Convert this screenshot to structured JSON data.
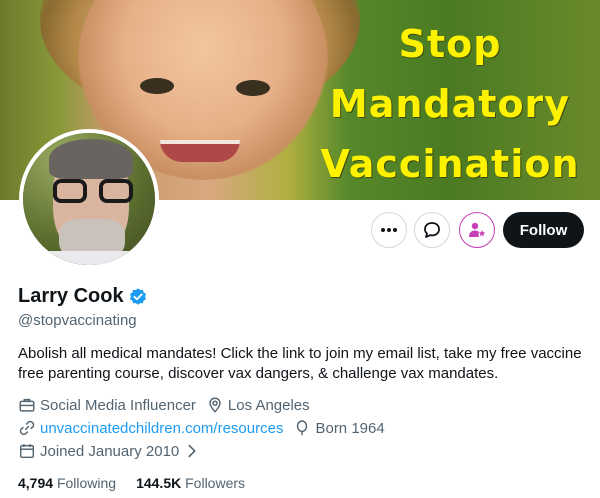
{
  "banner": {
    "text_lines": [
      "Stop",
      "Mandatory",
      "Vaccination"
    ]
  },
  "actions": {
    "more_icon": "more-dots-icon",
    "message_icon": "message-bubble-icon",
    "subscribe_icon": "subscribe-person-star-icon",
    "follow_label": "Follow"
  },
  "profile": {
    "name": "Larry Cook",
    "verified_icon": "verified-badge-icon",
    "handle": "@stopvaccinating",
    "bio": "Abolish all medical mandates! Click the link to join my email list, take my free vaccine free parenting course, discover vax dangers, & challenge vax mandates.",
    "category": "Social Media Influencer",
    "location": "Los Angeles",
    "website": "unvaccinatedchildren.com/resources",
    "born": "Born 1964",
    "joined": "Joined January 2010",
    "following_count": "4,794",
    "following_label": "Following",
    "followers_count": "144.5K",
    "followers_label": "Followers"
  },
  "colors": {
    "accent": "#1d9bf0",
    "text_primary": "#0f1419",
    "text_secondary": "#536471",
    "follow_bg": "#0f1419",
    "subscribe_accent": "#c63fb7",
    "banner_text": "#fff200"
  }
}
